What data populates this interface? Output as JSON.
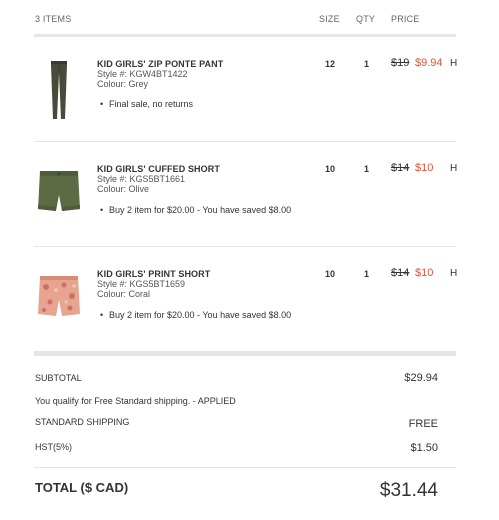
{
  "header": {
    "items_count": "3 ITEMS",
    "size_label": "SIZE",
    "qty_label": "QTY",
    "price_label": "PRICE"
  },
  "items": [
    {
      "name": "KID GIRLS' ZIP PONTE PANT",
      "style": "Style #: KGW4BT1422",
      "colour": "Colour: Grey",
      "note": "Final sale, no returns",
      "size": "12",
      "qty": "1",
      "price_old": "$19",
      "price_new": "$9.94",
      "price_suffix": "H",
      "image": "grey-pants-thumbnail"
    },
    {
      "name": "KID GIRLS' CUFFED SHORT",
      "style": "Style #: KGS5BT1661",
      "colour": "Colour: Olive",
      "note": "Buy 2 item for $20.00 - You have saved $8.00",
      "size": "10",
      "qty": "1",
      "price_old": "$14",
      "price_new": "$10",
      "price_suffix": "H",
      "image": "olive-shorts-thumbnail"
    },
    {
      "name": "KID GIRLS' PRINT SHORT",
      "style": "Style #: KGS5BT1659",
      "colour": "Colour: Coral",
      "note": "Buy 2 item for $20.00 - You have saved $8.00",
      "size": "10",
      "qty": "1",
      "price_old": "$14",
      "price_new": "$10",
      "price_suffix": "H",
      "image": "coral-print-shorts-thumbnail"
    }
  ],
  "summary": {
    "subtotal_label": "SUBTOTAL",
    "subtotal_value": "$29.94",
    "free_shipping_note": "You qualify for Free Standard shipping. - APPLIED",
    "shipping_label": "STANDARD SHIPPING",
    "shipping_value": "FREE",
    "tax_label": "HST(5%)",
    "tax_value": "$1.50",
    "total_label": "TOTAL ($ CAD)",
    "total_value": "$31.44"
  },
  "colors": {
    "sale_price": "#e2513a",
    "divider": "#e6e6e6",
    "text": "#333333"
  }
}
